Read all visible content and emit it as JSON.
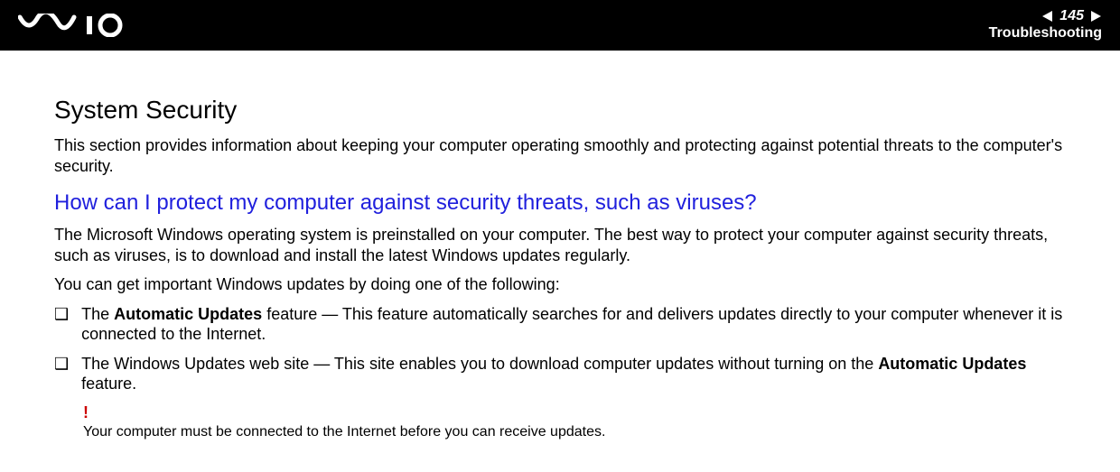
{
  "header": {
    "page_number": "145",
    "section": "Troubleshooting"
  },
  "content": {
    "title": "System Security",
    "intro": "This section provides information about keeping your computer operating smoothly and protecting against potential threats to the computer's security.",
    "question": "How can I protect my computer against security threats, such as viruses?",
    "answer1": "The Microsoft Windows operating system is preinstalled on your computer. The best way to protect your computer against security threats, such as viruses, is to download and install the latest Windows updates regularly.",
    "answer2": "You can get important Windows updates by doing one of the following:",
    "bullets": [
      {
        "pre": "The ",
        "bold": "Automatic Updates",
        "post": " feature — This feature automatically searches for and delivers updates directly to your computer whenever it is connected to the Internet."
      },
      {
        "pre": "The Windows Updates web site — This site enables you to download computer updates without turning on the ",
        "bold": "Automatic Updates",
        "post": " feature."
      }
    ],
    "note_icon": "!",
    "note_text": "Your computer must be connected to the Internet before you can receive updates.",
    "bullet_marker": "❑"
  }
}
